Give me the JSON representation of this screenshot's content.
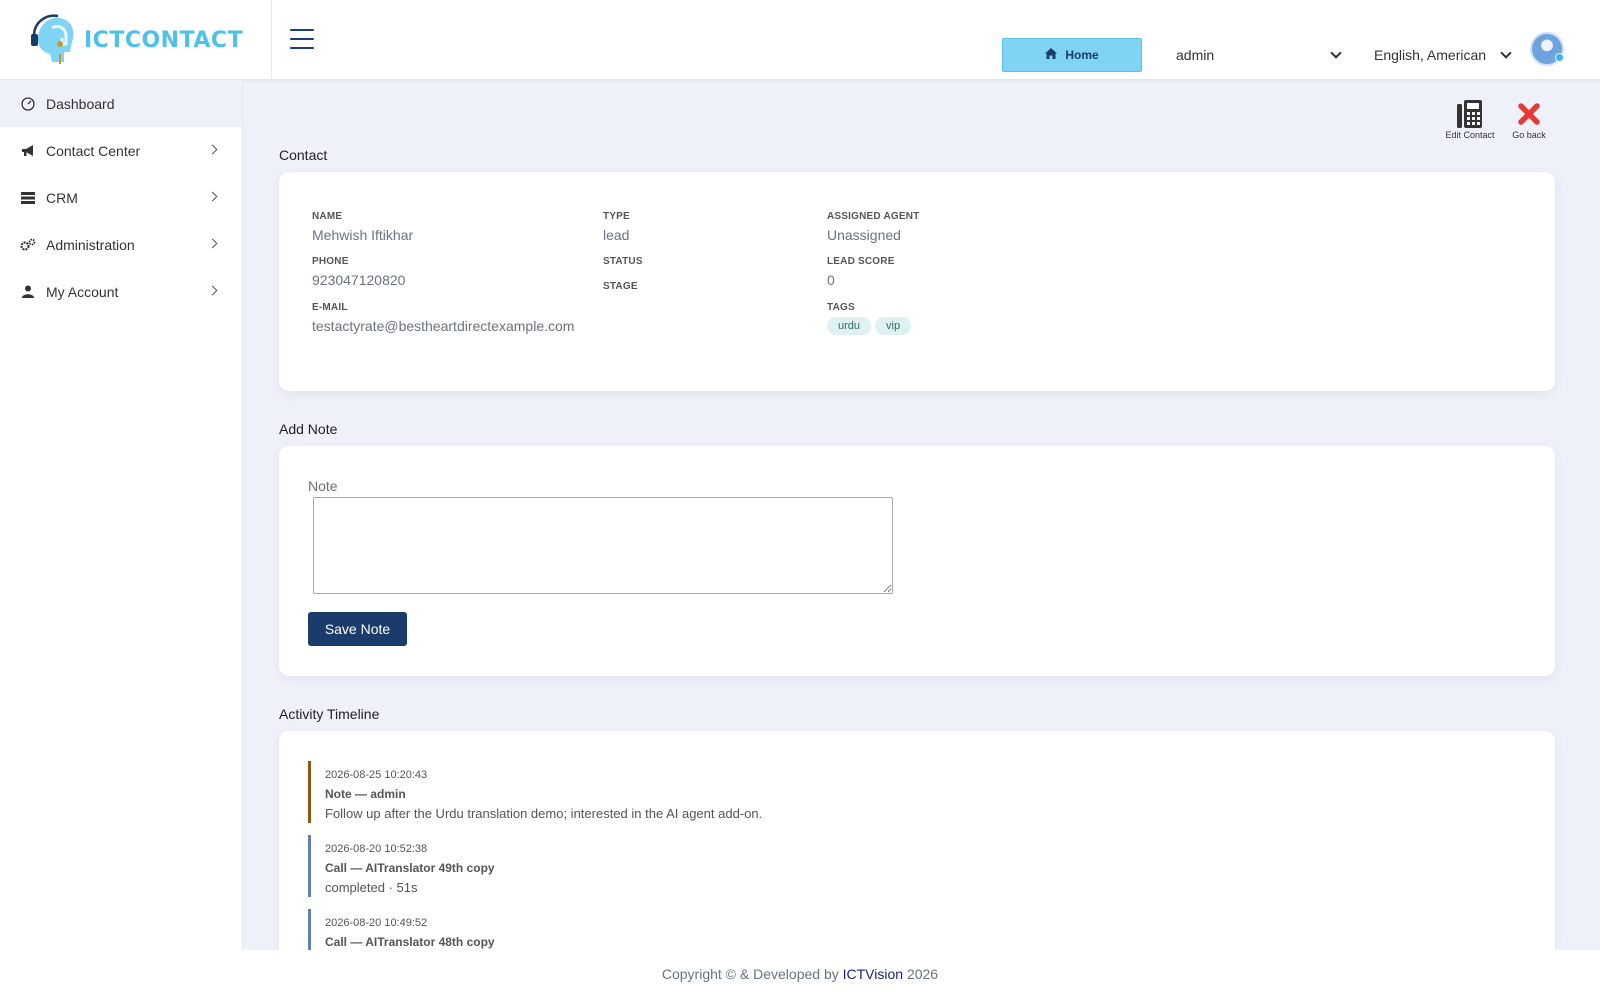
{
  "header": {
    "logo_text": "ICTCONTACT",
    "home_label": "Home",
    "user_select": "admin",
    "language_select": "English, American"
  },
  "sidebar": {
    "items": [
      {
        "label": "Dashboard",
        "icon": "dashboard-icon"
      },
      {
        "label": "Contact Center",
        "icon": "bullhorn-icon"
      },
      {
        "label": "CRM",
        "icon": "server-icon"
      },
      {
        "label": "Administration",
        "icon": "gears-icon"
      },
      {
        "label": "My Account",
        "icon": "user-icon"
      }
    ]
  },
  "actions": {
    "edit_label": "Edit Contact",
    "back_label": "Go back"
  },
  "contact": {
    "title": "Contact",
    "name_label": "NAME",
    "name": "Mehwish Iftikhar",
    "phone_label": "PHONE",
    "phone": "923047120820",
    "email_label": "E-MAIL",
    "email": "testactyrate@bestheartdirectexample.com",
    "type_label": "TYPE",
    "type": "lead",
    "status_label": "STATUS",
    "stage_label": "STAGE",
    "agent_label": "ASSIGNED AGENT",
    "agent": "Unassigned",
    "score_label": "LEAD SCORE",
    "score": "0",
    "tags_label": "TAGS",
    "tags": [
      "urdu",
      "vip"
    ]
  },
  "note": {
    "title": "Add Note",
    "label": "Note",
    "value": "",
    "save_label": "Save Note"
  },
  "timeline": {
    "title": "Activity Timeline",
    "items": [
      {
        "time": "2026-08-25 10:20:43",
        "head": "Note — admin",
        "body": "Follow up after the Urdu translation demo; interested in the AI agent add-on."
      },
      {
        "time": "2026-08-20 10:52:38",
        "head": "Call — AITranslator 49th copy",
        "body": "completed · 51s"
      },
      {
        "time": "2026-08-20 10:49:52",
        "head": "Call — AITranslator 48th copy",
        "body": ""
      }
    ]
  },
  "footer": {
    "prefix": "Copyright © & Developed by",
    "link": "ICTVision",
    "year": "2026"
  },
  "colors": {
    "brand": "#4ec0ee",
    "primary": "#1b3c6b",
    "home_button": "#7fd3f3",
    "background": "#eef0fa",
    "note_border": "#8a5a12",
    "call_border": "#5f7fb1",
    "close_red": "#e53935"
  }
}
